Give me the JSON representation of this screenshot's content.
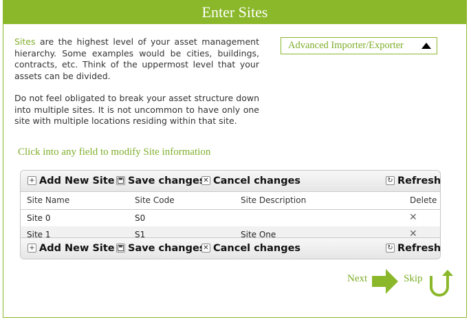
{
  "header": {
    "title": "Enter Sites"
  },
  "intro": {
    "highlight": "Sites",
    "p1_rest": " are the highest level of your asset management hierarchy. Some examples would be cities, buildings, contracts, etc. Think of the uppermost level that your assets can be divided.",
    "p2": "Do not feel obligated to break your asset structure down into multiple sites. It is not uncommon to have only one site with multiple locations residing within that site."
  },
  "importer": {
    "label": "Advanced Importer/Exporter"
  },
  "instruction": "Click into any field to modify Site information",
  "toolbar": {
    "add_label": "Add New Site",
    "save_label": "Save changes",
    "cancel_label": "Cancel changes",
    "refresh_label": "Refresh"
  },
  "table": {
    "columns": [
      "Site Name",
      "Site Code",
      "Site Description",
      "Delete"
    ],
    "rows": [
      {
        "name": "Site 0",
        "code": "S0",
        "description": ""
      },
      {
        "name": "Site 1",
        "code": "S1",
        "description": "Site One"
      }
    ]
  },
  "nav": {
    "next_label": "Next",
    "skip_label": "Skip"
  },
  "colors": {
    "accent": "#8bb82a",
    "text_green": "#7fae2a"
  }
}
